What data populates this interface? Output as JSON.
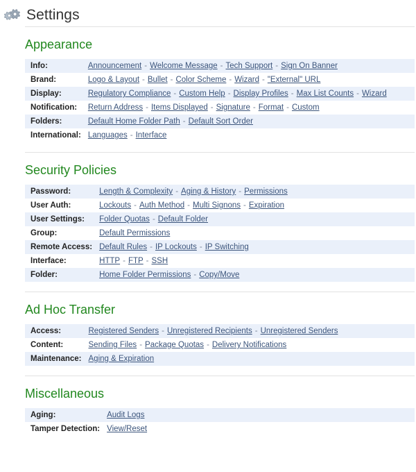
{
  "header": {
    "title": "Settings",
    "icon": "gears-icon"
  },
  "colors": {
    "section_heading": "#22881f",
    "link": "#3b547b",
    "stripe": "#eaf0fa",
    "title": "#333333",
    "rule": "#e2e2e2"
  },
  "sections": [
    {
      "title": "Appearance",
      "rows": [
        {
          "label": "Info:",
          "links": [
            "Announcement",
            "Welcome Message",
            "Tech Support",
            "Sign On Banner"
          ]
        },
        {
          "label": "Brand:",
          "links": [
            "Logo & Layout",
            "Bullet",
            "Color Scheme",
            "Wizard",
            "\"External\" URL"
          ]
        },
        {
          "label": "Display:",
          "links": [
            "Regulatory Compliance",
            "Custom Help",
            "Display Profiles",
            "Max List Counts",
            "Wizard"
          ]
        },
        {
          "label": "Notification:",
          "links": [
            "Return Address",
            "Items Displayed",
            "Signature",
            "Format",
            "Custom"
          ]
        },
        {
          "label": "Folders:",
          "links": [
            "Default Home Folder Path",
            "Default Sort Order"
          ]
        },
        {
          "label": "International:",
          "links": [
            "Languages",
            "Interface"
          ]
        }
      ]
    },
    {
      "title": "Security Policies",
      "rows": [
        {
          "label": "Password:",
          "links": [
            "Length & Complexity",
            "Aging & History",
            "Permissions"
          ]
        },
        {
          "label": "User Auth:",
          "links": [
            "Lockouts",
            "Auth Method",
            "Multi Signons",
            "Expiration"
          ]
        },
        {
          "label": "User Settings:",
          "links": [
            "Folder Quotas",
            "Default Folder"
          ]
        },
        {
          "label": "Group:",
          "links": [
            "Default Permissions"
          ]
        },
        {
          "label": "Remote Access:",
          "links": [
            "Default Rules",
            "IP Lockouts",
            "IP Switching"
          ]
        },
        {
          "label": "Interface:",
          "links": [
            "HTTP",
            "FTP",
            "SSH"
          ]
        },
        {
          "label": "Folder:",
          "links": [
            "Home Folder Permissions",
            "Copy/Move"
          ]
        }
      ]
    },
    {
      "title": "Ad Hoc Transfer",
      "rows": [
        {
          "label": "Access:",
          "links": [
            "Registered Senders",
            "Unregistered Recipients",
            "Unregistered Senders"
          ]
        },
        {
          "label": "Content:",
          "links": [
            "Sending Files",
            "Package Quotas",
            "Delivery Notifications"
          ]
        },
        {
          "label": "Maintenance:",
          "links": [
            "Aging & Expiration"
          ]
        }
      ]
    },
    {
      "title": "Miscellaneous",
      "rows": [
        {
          "label": "Aging:",
          "links": [
            "Audit Logs"
          ]
        },
        {
          "label": "Tamper Detection:",
          "links": [
            "View/Reset"
          ]
        }
      ]
    }
  ]
}
